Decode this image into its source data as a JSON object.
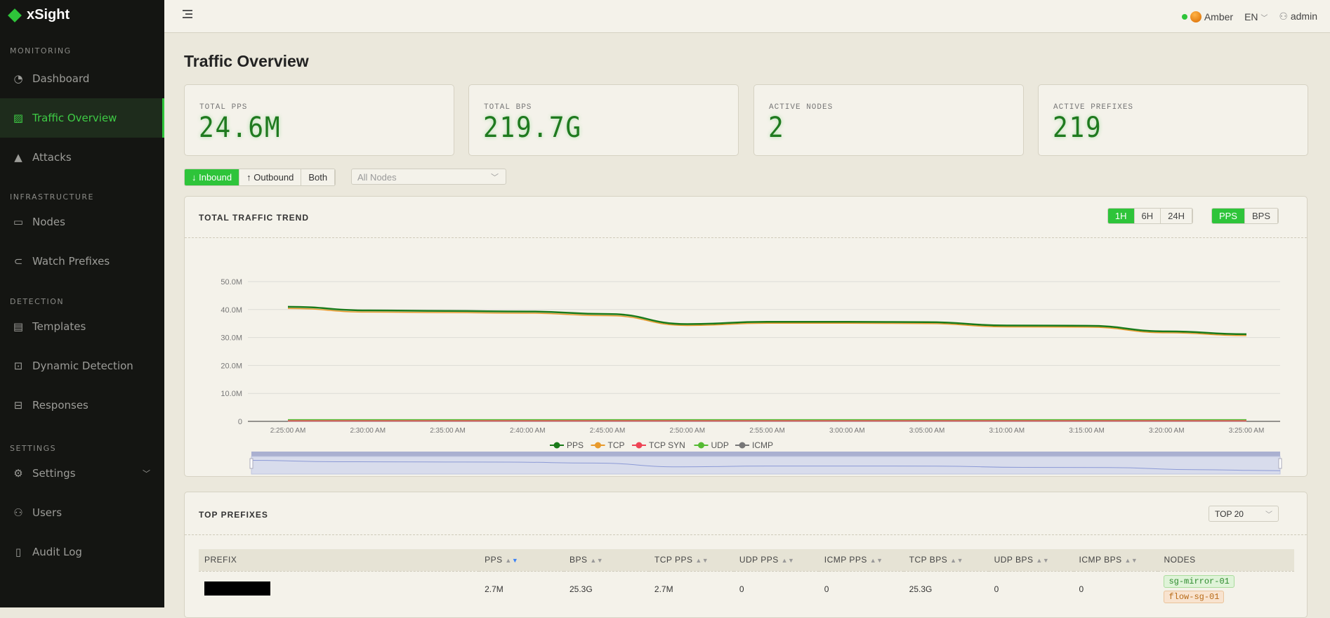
{
  "app": {
    "name": "xSight",
    "accent": "#2ec43a"
  },
  "sidebar": {
    "sections": [
      {
        "title": "MONITORING",
        "items": [
          {
            "label": "Dashboard",
            "icon": "gauge-icon"
          },
          {
            "label": "Traffic Overview",
            "icon": "chart-icon",
            "active": true
          },
          {
            "label": "Attacks",
            "icon": "warning-icon"
          }
        ]
      },
      {
        "title": "INFRASTRUCTURE",
        "items": [
          {
            "label": "Nodes",
            "icon": "monitor-icon"
          },
          {
            "label": "Watch Prefixes",
            "icon": "link-icon"
          }
        ]
      },
      {
        "title": "DETECTION",
        "items": [
          {
            "label": "Templates",
            "icon": "layers-icon"
          },
          {
            "label": "Dynamic Detection",
            "icon": "presentation-icon"
          },
          {
            "label": "Responses",
            "icon": "sliders-icon"
          }
        ]
      },
      {
        "title": "SETTINGS",
        "items": [
          {
            "label": "Settings",
            "icon": "gear-icon"
          },
          {
            "label": "Users",
            "icon": "user-icon"
          },
          {
            "label": "Audit Log",
            "icon": "file-icon"
          }
        ]
      }
    ]
  },
  "topbar": {
    "theme": "Amber",
    "lang": "EN",
    "user": "admin"
  },
  "page": {
    "title": "Traffic Overview"
  },
  "cards": [
    {
      "label": "TOTAL PPS",
      "value": "24.6M"
    },
    {
      "label": "TOTAL BPS",
      "value": "219.7G"
    },
    {
      "label": "ACTIVE NODES",
      "value": "2"
    },
    {
      "label": "ACTIVE PREFIXES",
      "value": "219"
    }
  ],
  "direction": {
    "options": [
      "↓ Inbound",
      "↑ Outbound",
      "Both"
    ],
    "selected": "↓ Inbound"
  },
  "node_filter": {
    "placeholder": "All Nodes"
  },
  "trend": {
    "title": "TOTAL TRAFFIC TREND",
    "ranges": [
      "1H",
      "6H",
      "24H"
    ],
    "range_selected": "1H",
    "metrics": [
      "PPS",
      "BPS"
    ],
    "metric_selected": "PPS"
  },
  "chart_data": {
    "type": "line",
    "ylim": [
      0,
      50000000
    ],
    "yticks": [
      "0",
      "10.0M",
      "20.0M",
      "30.0M",
      "40.0M",
      "50.0M"
    ],
    "x": [
      "2:25:00 AM",
      "2:30:00 AM",
      "2:35:00 AM",
      "2:40:00 AM",
      "2:45:00 AM",
      "2:50:00 AM",
      "2:55:00 AM",
      "3:00:00 AM",
      "3:05:00 AM",
      "3:10:00 AM",
      "3:15:00 AM",
      "3:20:00 AM",
      "3:25:00 AM"
    ],
    "series": [
      {
        "name": "PPS",
        "color": "#1a7a1a",
        "values": [
          41000000,
          39700000,
          39500000,
          39300000,
          38400000,
          34800000,
          35600000,
          35600000,
          35500000,
          34300000,
          34200000,
          32200000,
          31200000
        ]
      },
      {
        "name": "TCP",
        "color": "#e89a2c",
        "values": [
          40400000,
          39100000,
          38900000,
          38700000,
          37800000,
          34300000,
          35100000,
          35100000,
          35000000,
          33800000,
          33700000,
          31700000,
          30700000
        ]
      },
      {
        "name": "TCP SYN",
        "color": "#ee4455",
        "values": [
          200000,
          200000,
          200000,
          200000,
          200000,
          200000,
          200000,
          200000,
          200000,
          200000,
          200000,
          200000,
          200000
        ]
      },
      {
        "name": "UDP",
        "color": "#55bb33",
        "values": [
          600000,
          600000,
          600000,
          600000,
          600000,
          600000,
          600000,
          600000,
          600000,
          600000,
          600000,
          600000,
          600000
        ]
      },
      {
        "name": "ICMP",
        "color": "#777777",
        "values": [
          50000,
          50000,
          50000,
          50000,
          50000,
          50000,
          50000,
          50000,
          50000,
          50000,
          50000,
          50000,
          50000
        ]
      }
    ],
    "legend": "bottom",
    "grid": true
  },
  "prefixes": {
    "title": "TOP PREFIXES",
    "top": "TOP 20",
    "columns": [
      "PREFIX",
      "PPS",
      "BPS",
      "TCP PPS",
      "UDP PPS",
      "ICMP PPS",
      "TCP BPS",
      "UDP BPS",
      "ICMP BPS",
      "NODES"
    ],
    "rows": [
      {
        "prefix": "",
        "pps": "2.7M",
        "bps": "25.3G",
        "tcp_pps": "2.7M",
        "udp_pps": "0",
        "icmp_pps": "0",
        "tcp_bps": "25.3G",
        "udp_bps": "0",
        "icmp_bps": "0",
        "nodes": [
          "sg-mirror-01",
          "flow-sg-01"
        ]
      }
    ]
  }
}
